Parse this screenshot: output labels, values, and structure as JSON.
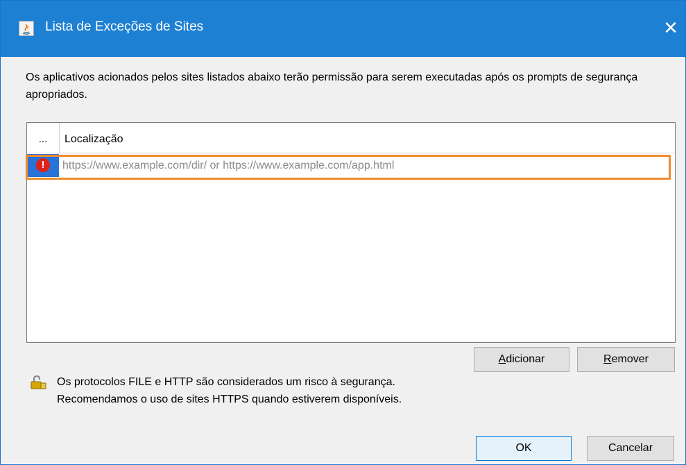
{
  "window": {
    "title": "Lista de Exceções de Sites",
    "close_symbol": "✕",
    "accent_color": "#1e80d2"
  },
  "description": "Os aplicativos acionados pelos sites listados abaixo terão permissão para serem executadas após os prompts de segurança apropriados.",
  "table": {
    "columns": [
      "...",
      "Localização"
    ],
    "rows": [
      {
        "status_icon": "error-icon",
        "status_glyph": "!",
        "location_value": "",
        "location_placeholder": "https://www.example.com/dir/ or https://www.example.com/app.html"
      }
    ]
  },
  "buttons": {
    "add_mnemonic": "A",
    "add_rest": "dicionar",
    "remove_mnemonic": "R",
    "remove_rest": "emover",
    "ok": "OK",
    "cancel": "Cancelar"
  },
  "security_warning": {
    "icon": "lock-icon",
    "line1": "Os protocolos FILE e HTTP são considerados um risco à segurança.",
    "line2": "Recomendamos o uso de sites HTTPS quando estiverem disponíveis."
  },
  "colors": {
    "highlight": "#ef8a2f",
    "row_selected": "#2a73d6",
    "error": "#e0201b"
  }
}
